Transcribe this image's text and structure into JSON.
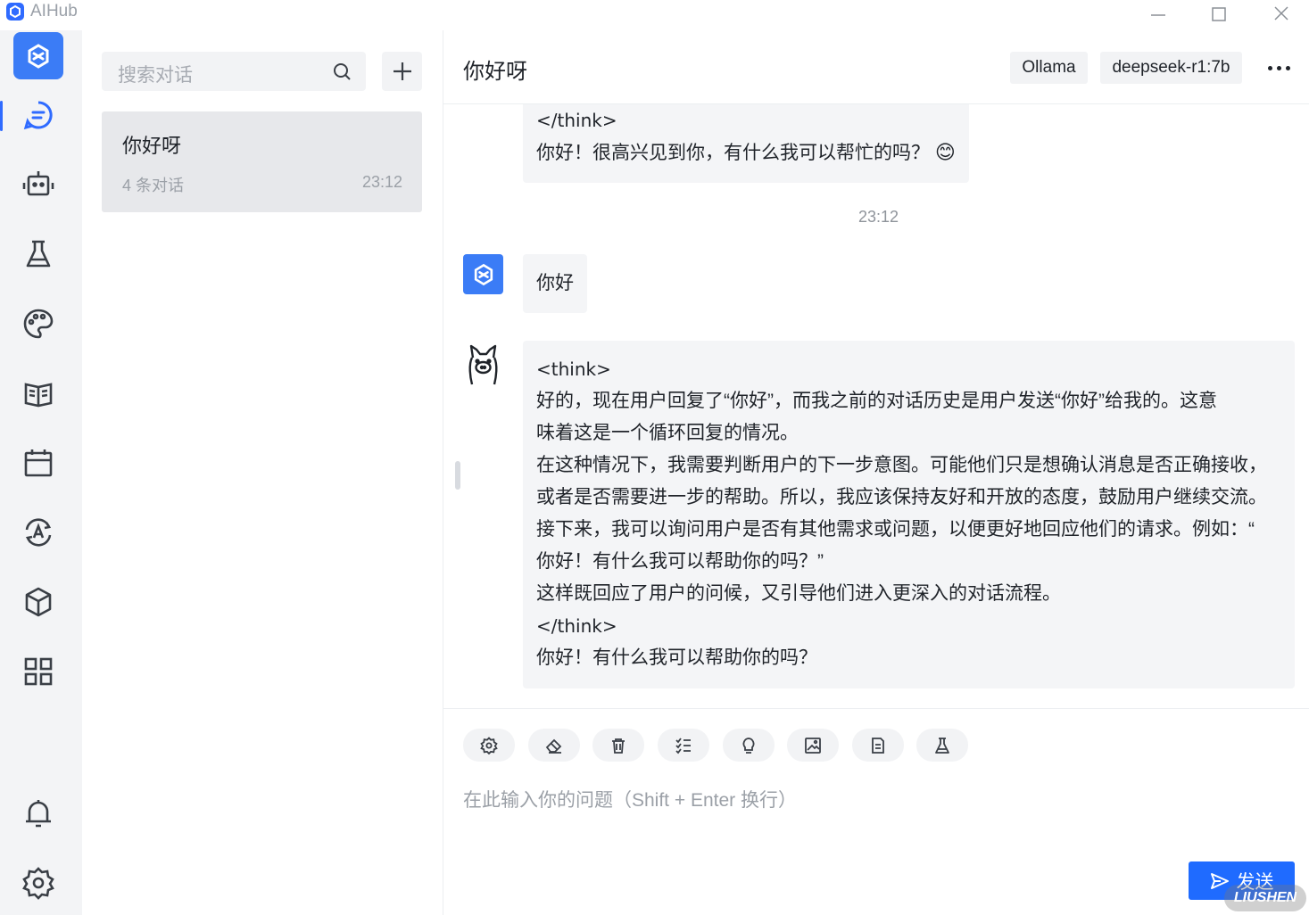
{
  "app": {
    "title": "AIHub"
  },
  "search": {
    "placeholder": "搜索对话"
  },
  "conversation": {
    "title": "你好呀",
    "count": "4 条对话",
    "time": "23:12"
  },
  "header": {
    "title": "你好呀",
    "provider": "Ollama",
    "model": "deepseek-r1:7b"
  },
  "messages": {
    "first_tail": [
      "</think>",
      "你好！很高兴见到你，有什么我可以帮忙的吗？"
    ],
    "emoji": "😊",
    "timestamp": "23:12",
    "user_text": "你好",
    "reply_lines": [
      "<think>",
      "好的，现在用户回复了“你好”，而我之前的对话历史是用户发送“你好”给我的。这意",
      "味着这是一个循环回复的情况。",
      "在这种情况下，我需要判断用户的下一步意图。可能他们只是想确认消息是否正确接收，",
      "或者是否需要进一步的帮助。所以，我应该保持友好和开放的态度，鼓励用户继续交流。",
      "接下来，我可以询问用户是否有其他需求或问题，以便更好地回应他们的请求。例如：“",
      "你好！有什么我可以帮助你的吗？”",
      "这样既回应了用户的问候，又引导他们进入更深入的对话流程。",
      "</think>",
      "你好！有什么我可以帮助你的吗？"
    ]
  },
  "composer": {
    "placeholder": "在此输入你的问题（Shift + Enter 换行）",
    "send_label": "发送"
  },
  "watermark": "LIUSHEN",
  "colors": {
    "accent": "#1f6bff",
    "rail_bg": "#f3f4f6",
    "bubble_bg": "#f4f5f7"
  }
}
